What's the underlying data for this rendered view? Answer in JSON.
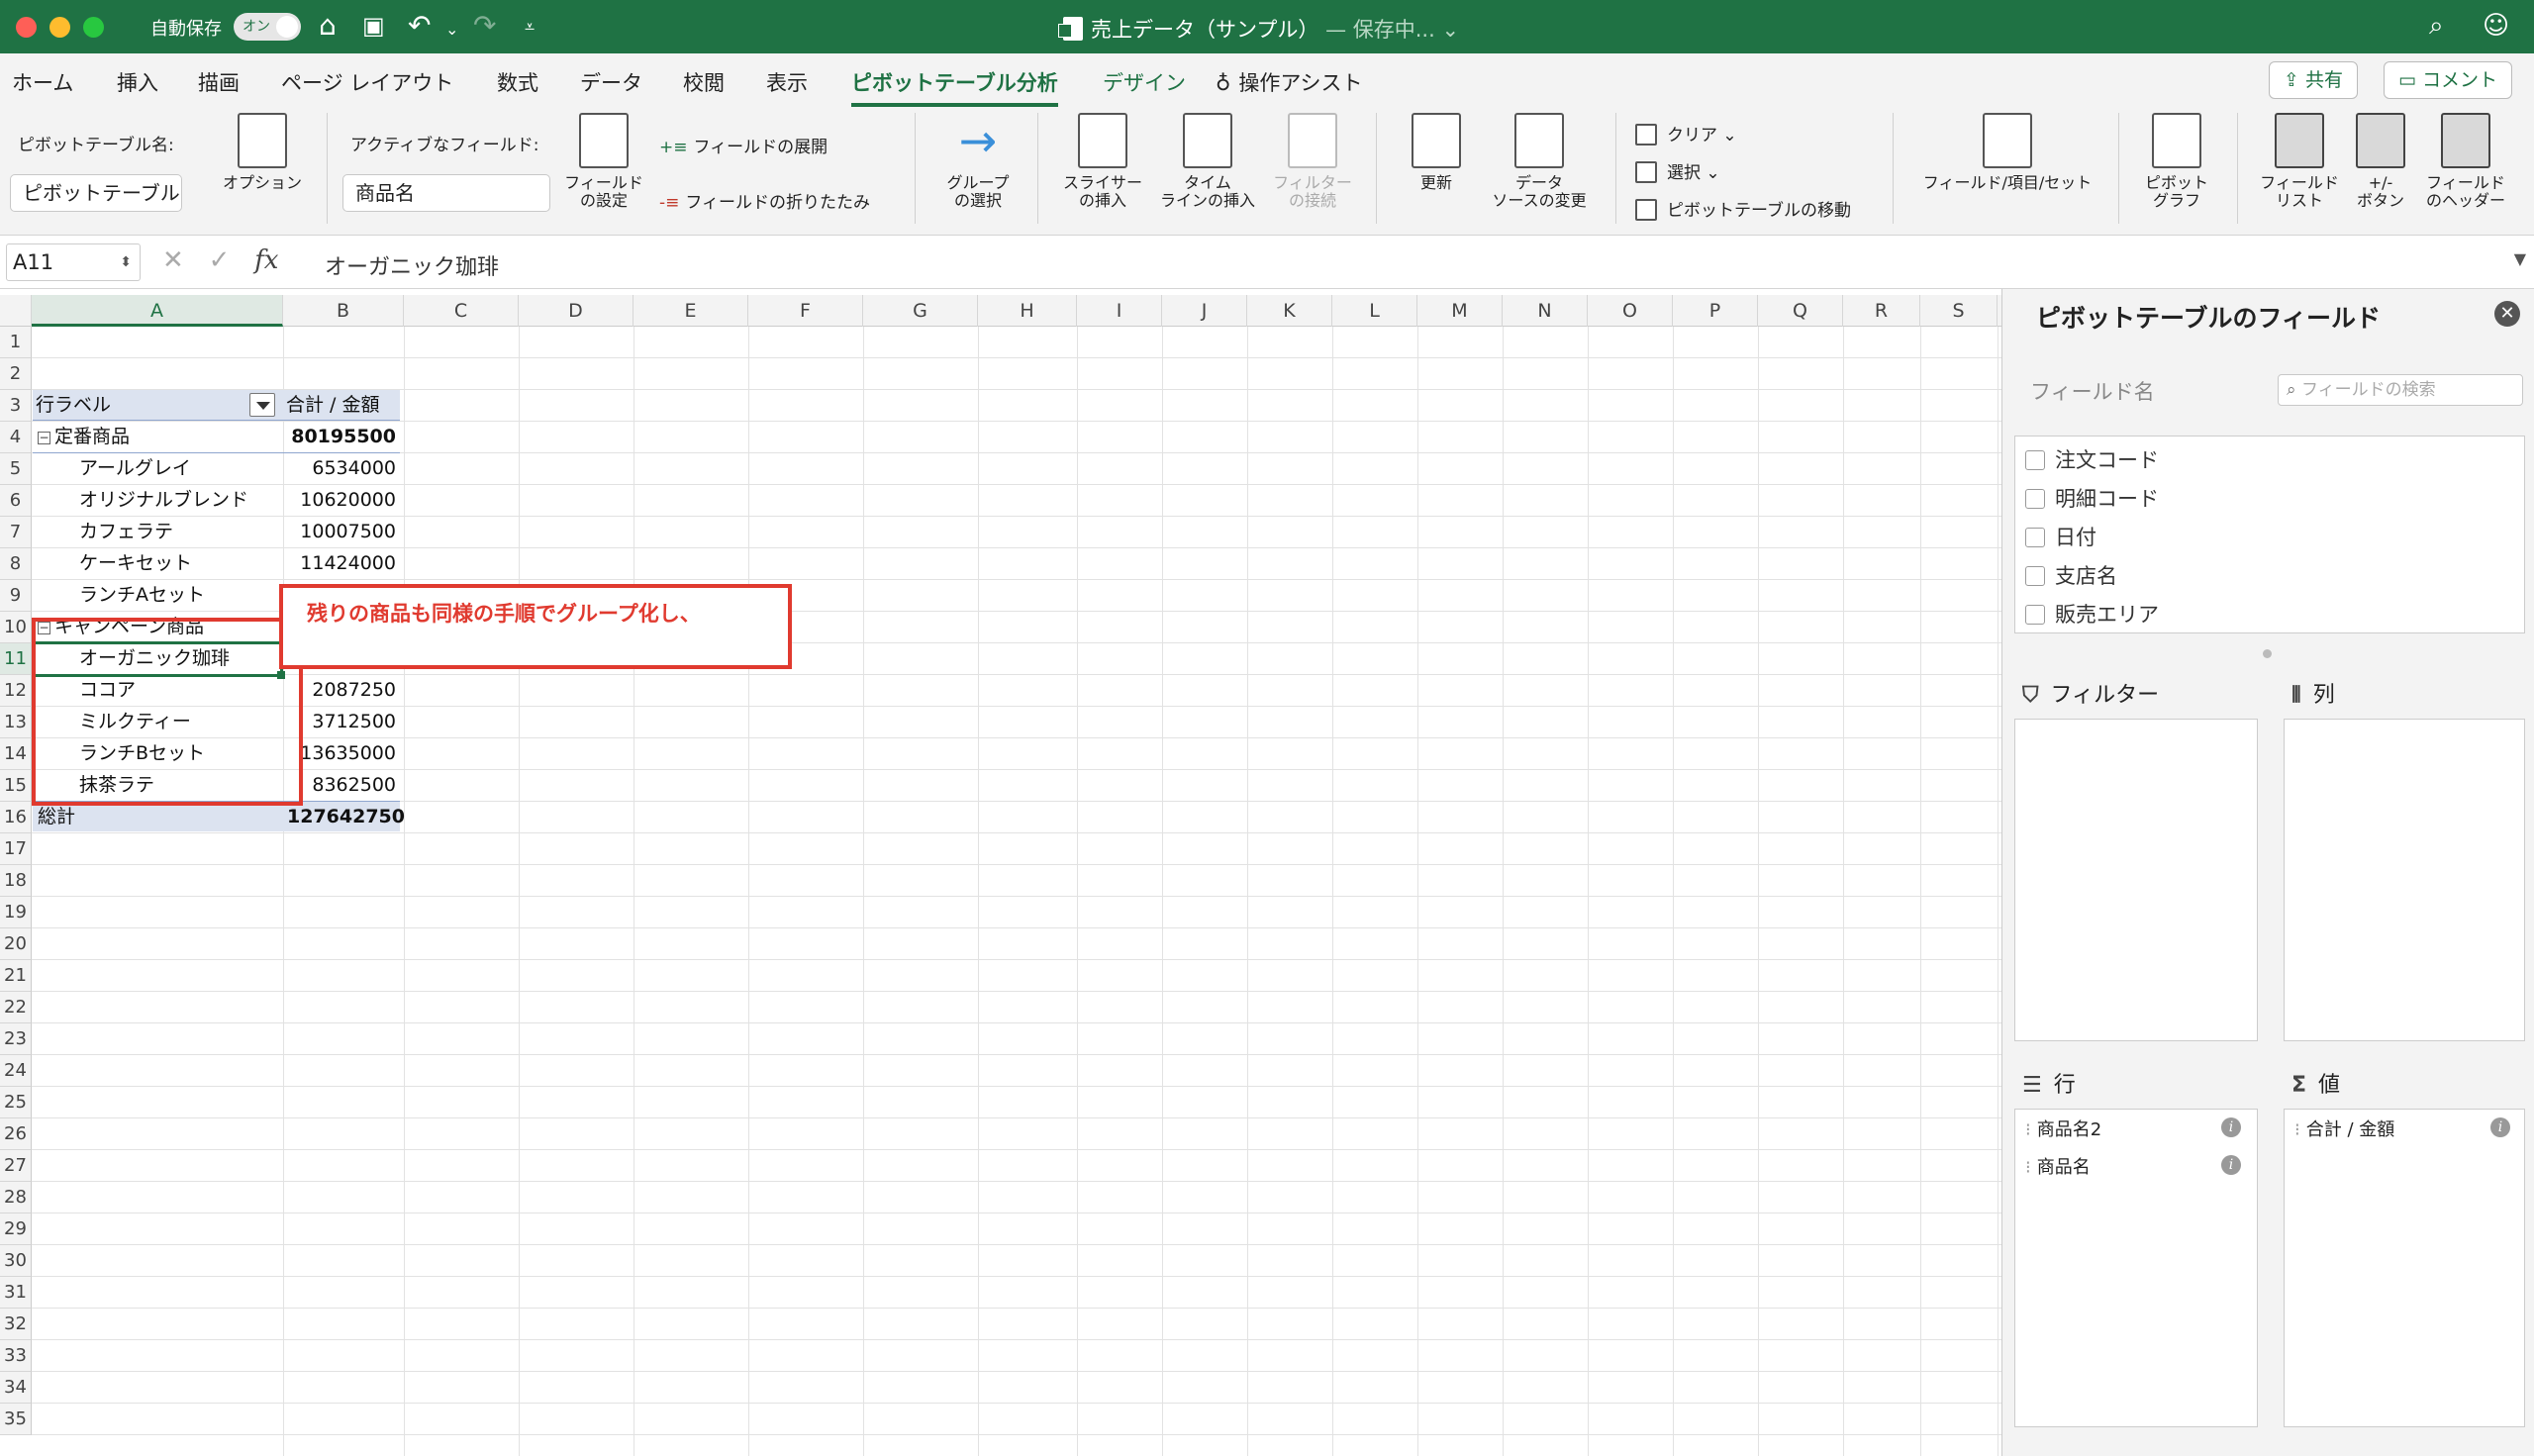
{
  "titlebar": {
    "autosave_label": "自動保存",
    "autosave_state": "オン",
    "doc_title": "売上データ（サンプル）",
    "doc_status": "— 保存中...",
    "accent": "#1f7244"
  },
  "menu": {
    "items": [
      "ホーム",
      "挿入",
      "描画",
      "ページ レイアウト",
      "数式",
      "データ",
      "校閲",
      "表示",
      "ピボットテーブル分析",
      "デザイン",
      "操作アシスト"
    ],
    "active": "ピボットテーブル分析",
    "share": "共有",
    "comment": "コメント"
  },
  "ribbon": {
    "pt_name_label": "ピボットテーブル名:",
    "pt_name_value": "ピボットテーブル",
    "options": "オプション",
    "active_field_label": "アクティブなフィールド:",
    "active_field_value": "商品名",
    "field_settings_l1": "フィールド",
    "field_settings_l2": "の設定",
    "expand_field": "フィールドの展開",
    "collapse_field": "フィールドの折りたたみ",
    "group_l1": "グループ",
    "group_l2": "の選択",
    "slicer_l1": "スライサー",
    "slicer_l2": "の挿入",
    "timeline_l1": "タイム",
    "timeline_l2": "ラインの挿入",
    "filter_conn_l1": "フィルター",
    "filter_conn_l2": "の接続",
    "refresh": "更新",
    "data_source_l1": "データ",
    "data_source_l2": "ソースの変更",
    "clear": "クリア",
    "select": "選択",
    "move_pt": "ピボットテーブルの移動",
    "fields_items_sets": "フィールド/項目/セット",
    "pivot_chart_l1": "ピボット",
    "pivot_chart_l2": "グラフ",
    "field_list_l1": "フィールド",
    "field_list_l2": "リスト",
    "plus_minus_l1": "+/-",
    "plus_minus_l2": "ボタン",
    "field_headers_l1": "フィールド",
    "field_headers_l2": "のヘッダー"
  },
  "formula_bar": {
    "cell_ref": "A11",
    "content": "オーガニック珈琲"
  },
  "grid": {
    "columns": [
      "A",
      "B",
      "C",
      "D",
      "E",
      "F",
      "G",
      "H",
      "I",
      "J",
      "K",
      "L",
      "M",
      "N",
      "O",
      "P",
      "Q",
      "R",
      "S"
    ],
    "rows": [
      "1",
      "2",
      "3",
      "4",
      "5",
      "6",
      "7",
      "8",
      "9",
      "10",
      "11",
      "12",
      "13",
      "14",
      "15",
      "16",
      "17",
      "18",
      "19",
      "20",
      "21",
      "22",
      "23",
      "24",
      "25",
      "26",
      "27",
      "28",
      "29",
      "30",
      "31",
      "32",
      "33",
      "34",
      "35"
    ],
    "pivot": {
      "header_label": "行ラベル",
      "header_value": "合計 / 金額",
      "group1_label": "定番商品",
      "group1_total": "80195500",
      "group1_items": [
        {
          "name": "アールグレイ",
          "value": "6534000"
        },
        {
          "name": "オリジナルブレンド",
          "value": "10620000"
        },
        {
          "name": "カフェラテ",
          "value": "10007500"
        },
        {
          "name": "ケーキセット",
          "value": "11424000"
        },
        {
          "name": "ランチAセット",
          "value": ""
        }
      ],
      "group2_label": "キャンペーン商品",
      "group2_items": [
        {
          "name": "オーガニック珈琲",
          "value": ""
        },
        {
          "name": "ココア",
          "value": "2087250"
        },
        {
          "name": "ミルクティー",
          "value": "3712500"
        },
        {
          "name": "ランチBセット",
          "value": "13635000"
        },
        {
          "name": "抹茶ラテ",
          "value": "8362500"
        }
      ],
      "total_label": "総計",
      "total_value": "127642750"
    },
    "callout": "残りの商品も同様の手順でグループ化し、",
    "annotation_color": "#e03a2f"
  },
  "pane": {
    "title": "ピボットテーブルのフィールド",
    "field_name_label": "フィールド名",
    "search_placeholder": "フィールドの検索",
    "fields": [
      "注文コード",
      "明細コード",
      "日付",
      "支店名",
      "販売エリア"
    ],
    "filters_label": "フィルター",
    "columns_label": "列",
    "rows_label": "行",
    "values_label": "値",
    "rows_items": [
      "商品名2",
      "商品名"
    ],
    "values_items": [
      "合計 / 金額"
    ]
  }
}
